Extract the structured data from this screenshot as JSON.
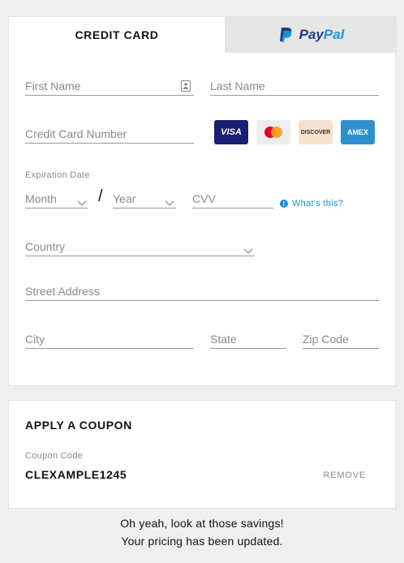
{
  "tabs": {
    "credit_card": "CREDIT CARD",
    "paypal_pay": "Pay",
    "paypal_pal": "Pal"
  },
  "fields": {
    "first_name": "First Name",
    "last_name": "Last Name",
    "card_number": "Credit Card Number",
    "expiration_label": "Expiration Date",
    "month": "Month",
    "separator": "/",
    "year": "Year",
    "cvv": "CVV",
    "whats_this": "What's this?",
    "country": "Country",
    "street": "Street Address",
    "city": "City",
    "state": "State",
    "zip": "Zip Code"
  },
  "card_brands": {
    "visa": "VISA",
    "discover": "DISCOVER",
    "amex": "AMEX"
  },
  "coupon": {
    "title": "APPLY A COUPON",
    "label": "Coupon Code",
    "code": "CLEXAMPLE1245",
    "remove": "REMOVE"
  },
  "note": {
    "line1": "Oh yeah, look at those savings!",
    "line2": "Your pricing has been updated."
  },
  "colors": {
    "paypal_dark": "#253b80",
    "paypal_light": "#179bd7",
    "link_blue": "#1a8ed4",
    "visa": "#1a1f71",
    "amex": "#2e8fcf"
  },
  "icons": [
    "contact-card-icon",
    "chevron-down-icon",
    "info-icon",
    "paypal-icon",
    "mastercard-icon"
  ]
}
